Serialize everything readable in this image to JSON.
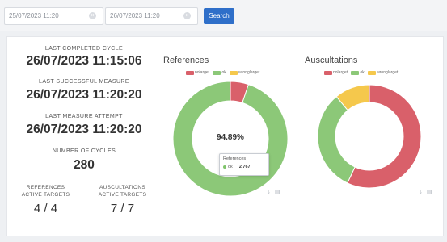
{
  "filters": {
    "from_date": "25/07/2023 11:20",
    "to_date": "26/07/2023 11:20",
    "clear_glyph": "×",
    "search_label": "Search"
  },
  "stats": {
    "last_completed_cycle_label": "LAST COMPLETED CYCLE",
    "last_completed_cycle_value": "26/07/2023 11:15:06",
    "last_successful_measure_label": "LAST SUCCESSFUL MEASURE",
    "last_successful_measure_value": "26/07/2023 11:20:20",
    "last_measure_attempt_label": "LAST MEASURE ATTEMPT",
    "last_measure_attempt_value": "26/07/2023 11:20:20",
    "number_of_cycles_label": "NUMBER OF CYCLES",
    "number_of_cycles_value": "280",
    "references_label_1": "REFERENCES",
    "references_label_2": "ACTIVE TARGETS",
    "references_value": "4 / 4",
    "auscultations_label_1": "AUSCULTATIONS",
    "auscultations_label_2": "ACTIVE TARGETS",
    "auscultations_value": "7 / 7"
  },
  "legend_labels": [
    "nolarget",
    "ok",
    "wronglarget"
  ],
  "colors": {
    "nolarget": "#d9606a",
    "ok": "#8cc878",
    "wronglarget": "#f5c84c"
  },
  "references_chart": {
    "title": "References",
    "center_text": "94.89%",
    "tooltip_title": "References",
    "tooltip_series": "ok",
    "tooltip_value": "2,767",
    "tools_glyph": "⤓ ▤"
  },
  "auscultations_chart": {
    "title": "Auscultations",
    "tools_glyph": "⤓ ▤"
  },
  "chart_data": [
    {
      "type": "pie",
      "title": "References",
      "categories": [
        "nolarget",
        "ok",
        "wronglarget"
      ],
      "values": [
        5.11,
        94.89,
        0
      ]
    },
    {
      "type": "pie",
      "title": "Auscultations",
      "categories": [
        "nolarget",
        "ok",
        "wronglarget"
      ],
      "values": [
        57,
        32,
        11
      ]
    }
  ]
}
